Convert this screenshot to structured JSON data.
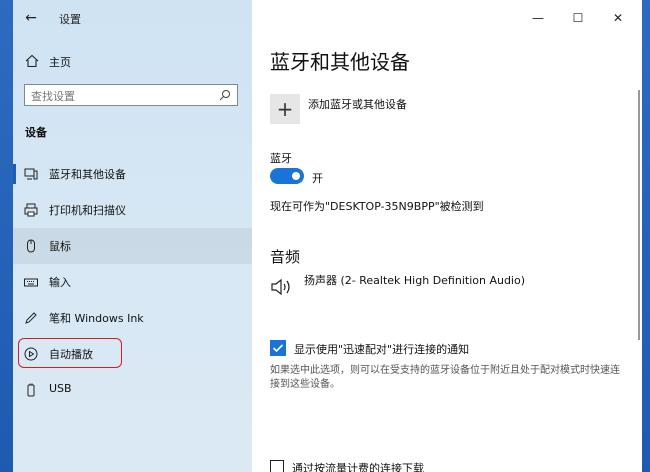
{
  "window": {
    "title": "设置"
  },
  "sidebar": {
    "home_label": "主页",
    "search_placeholder": "查找设置",
    "section_label": "设备",
    "items": [
      {
        "label": "蓝牙和其他设备",
        "icon": "bluetooth-devices-icon"
      },
      {
        "label": "打印机和扫描仪",
        "icon": "printer-icon"
      },
      {
        "label": "鼠标",
        "icon": "mouse-icon"
      },
      {
        "label": "输入",
        "icon": "keyboard-icon"
      },
      {
        "label": "笔和 Windows Ink",
        "icon": "pen-icon"
      },
      {
        "label": "自动播放",
        "icon": "autoplay-icon"
      },
      {
        "label": "USB",
        "icon": "usb-icon"
      }
    ]
  },
  "main": {
    "title": "蓝牙和其他设备",
    "add_device_label": "添加蓝牙或其他设备",
    "bluetooth_label": "蓝牙",
    "bluetooth_state": "开",
    "discoverable_text": "现在可作为\"DESKTOP-35N9BPP\"被检测到",
    "audio_heading": "音频",
    "speaker_label": "扬声器 (2- Realtek High Definition Audio)",
    "swift_pair_label": "显示使用\"迅速配对\"进行连接的通知",
    "swift_pair_desc": "如果选中此选项，则可以在受支持的蓝牙设备位于附近且处于配对模式时快速连接到这些设备。",
    "metered_label": "通过按流量计费的连接下载"
  },
  "colors": {
    "accent": "#1a73d9",
    "highlight_box": "#d81b1b"
  }
}
